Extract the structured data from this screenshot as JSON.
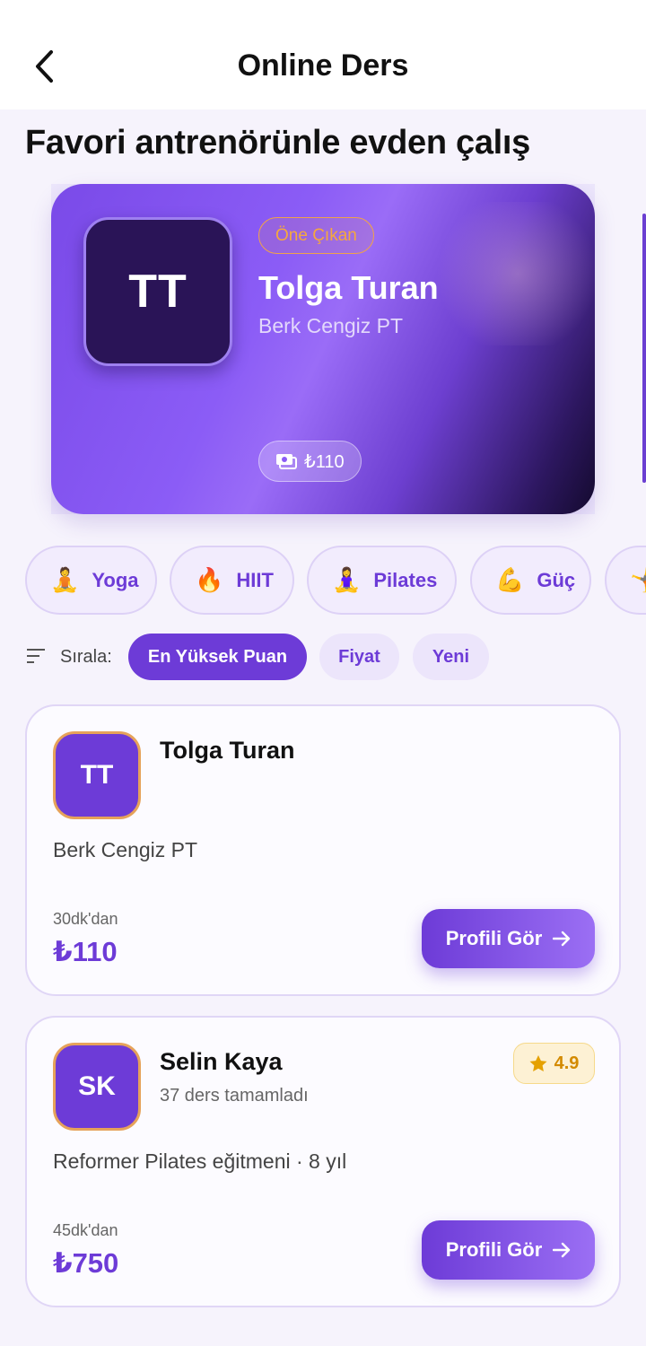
{
  "header": {
    "title": "Online Ders"
  },
  "heading": "Favori antrenörünle evden çalış",
  "featured": {
    "initials": "TT",
    "badge": "Öne Çıkan",
    "name": "Tolga Turan",
    "subtitle": "Berk Cengiz PT",
    "price": "₺110"
  },
  "categories": [
    {
      "emoji": "🧘",
      "label": "Yoga"
    },
    {
      "emoji": "🔥",
      "label": "HIIT"
    },
    {
      "emoji": "🧘‍♀️",
      "label": "Pilates"
    },
    {
      "emoji": "💪",
      "label": "Güç"
    },
    {
      "emoji": "🤸",
      "label": ""
    }
  ],
  "sort": {
    "label": "Sırala:",
    "options": [
      "En Yüksek Puan",
      "Fiyat",
      "Yeni"
    ],
    "selected": "En Yüksek Puan"
  },
  "trainers": [
    {
      "initials": "TT",
      "name": "Tolga Turan",
      "description": "Berk Cengiz PT",
      "duration": "30dk'dan",
      "price": "₺110",
      "button": "Profili Gör"
    },
    {
      "initials": "SK",
      "name": "Selin Kaya",
      "lessons": "37 ders tamamladı",
      "rating": "4.9",
      "description": "Reformer Pilates eğitmeni · 8 yıl",
      "duration": "45dk'dan",
      "price": "₺750",
      "button": "Profili Gör"
    }
  ],
  "colors": {
    "accent": "#6d3bd7",
    "badge": "#f5a83e",
    "rating": "#d38a00"
  },
  "icons": {
    "back": "chevron-left-icon",
    "sort": "sort-lines-icon",
    "price": "cash-icon",
    "arrow": "arrow-right-icon",
    "star": "star-icon"
  }
}
